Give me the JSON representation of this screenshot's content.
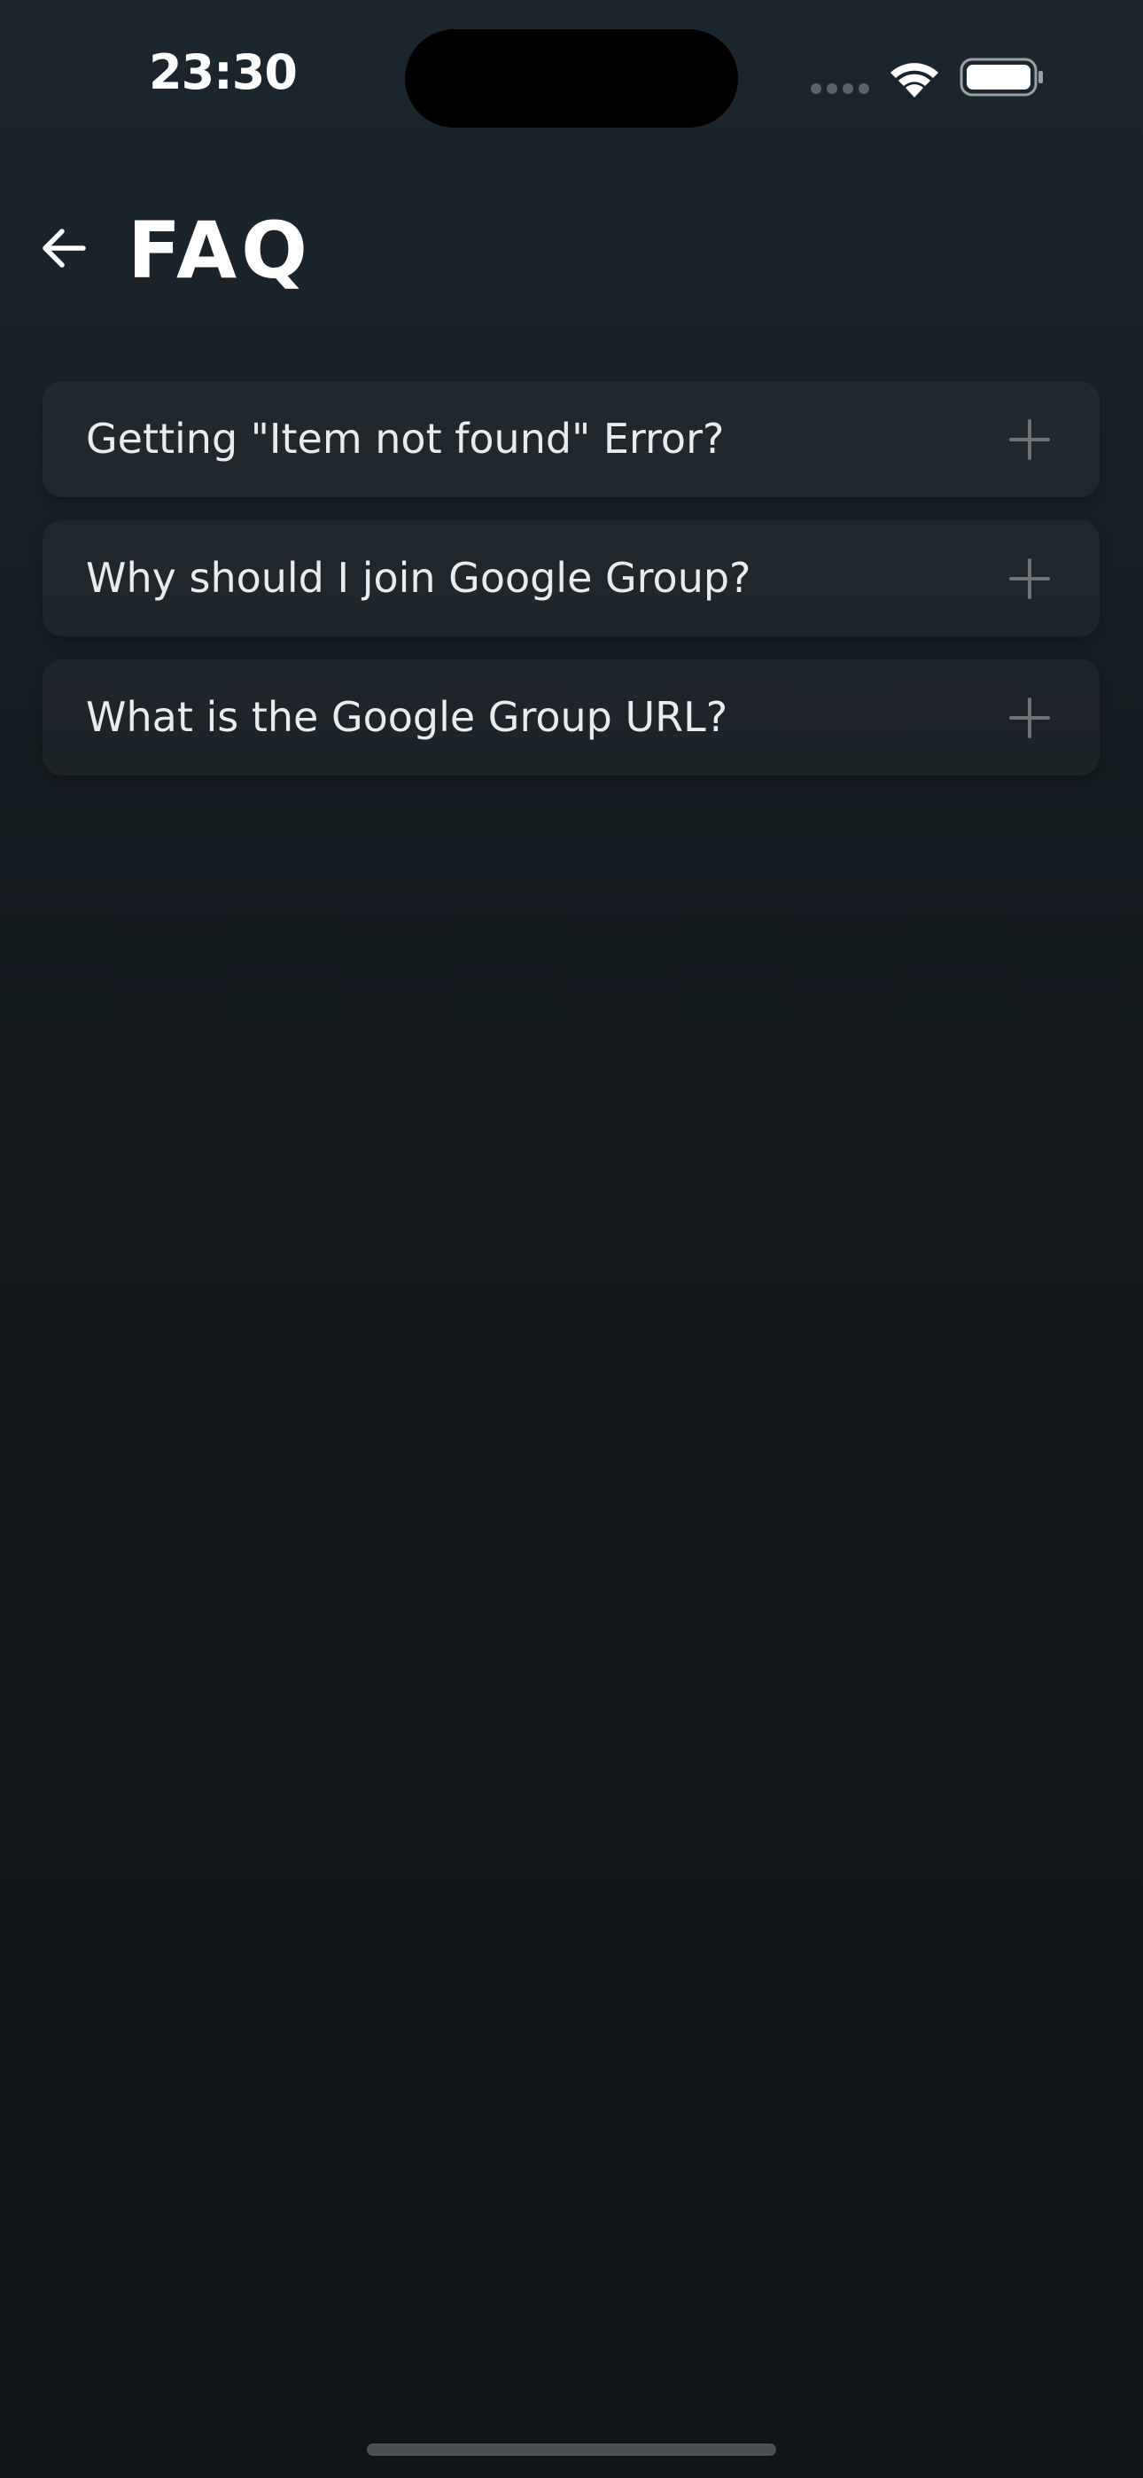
{
  "status_bar": {
    "time": "23:30",
    "signal_icon": "cellular-signal-icon",
    "wifi_icon": "wifi-icon",
    "battery_icon": "battery-icon"
  },
  "header": {
    "back_icon": "arrow-left-icon",
    "title": "FAQ"
  },
  "faq": {
    "expand_icon": "plus-icon",
    "items": [
      {
        "question": "Getting \"Item not found\" Error?"
      },
      {
        "question": "Why should I join Google Group?"
      },
      {
        "question": "What is the Google Group URL?"
      }
    ]
  },
  "colors": {
    "background_top": "#1c262e",
    "background_bottom": "#0f1416",
    "card": "#1d252b",
    "plus_icon": "#6e7378",
    "text": "#e9ecee"
  }
}
